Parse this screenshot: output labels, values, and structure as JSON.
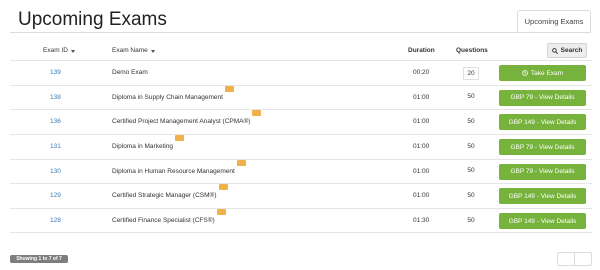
{
  "page": {
    "title": "Upcoming Exams"
  },
  "tabs": [
    {
      "label": "Upcoming Exams"
    }
  ],
  "table": {
    "headers": {
      "exam_id": "Exam ID",
      "exam_name": "Exam Name",
      "duration": "Duration",
      "questions": "Questions"
    },
    "search_label": "Search",
    "rows": [
      {
        "id": "139",
        "name": "Demo Exam",
        "badge": false,
        "duration": "00:20",
        "questions": "20",
        "action": "Take Exam",
        "action_icon": "clock-icon"
      },
      {
        "id": "138",
        "name": "Diploma in Supply Chain Management",
        "badge": true,
        "duration": "01:00",
        "questions": "50",
        "action": "GBP 79 - View Details"
      },
      {
        "id": "136",
        "name": "Certified Project Management Analyst (CPMA®)",
        "badge": true,
        "duration": "01:00",
        "questions": "50",
        "action": "GBP 149 - View Details"
      },
      {
        "id": "131",
        "name": "Diploma in Marketing",
        "badge": true,
        "duration": "01:00",
        "questions": "50",
        "action": "GBP 79 - View Details"
      },
      {
        "id": "130",
        "name": "Diploma in Human Resource Management",
        "badge": true,
        "duration": "01:00",
        "questions": "50",
        "action": "GBP 79 - View Details"
      },
      {
        "id": "129",
        "name": "Certified Strategic Manager (CSM®)",
        "badge": true,
        "duration": "01:00",
        "questions": "50",
        "action": "GBP 149 - View Details"
      },
      {
        "id": "128",
        "name": "Certified Finance Specialist (CFS®)",
        "badge": true,
        "duration": "01:30",
        "questions": "50",
        "action": "GBP 149 - View Details"
      }
    ]
  },
  "footer": {
    "showing": "Showing 1 to 7 of 7"
  },
  "colors": {
    "action_green": "#77b33c",
    "link_blue": "#3a7ab8",
    "badge_orange": "#f0b04a"
  }
}
